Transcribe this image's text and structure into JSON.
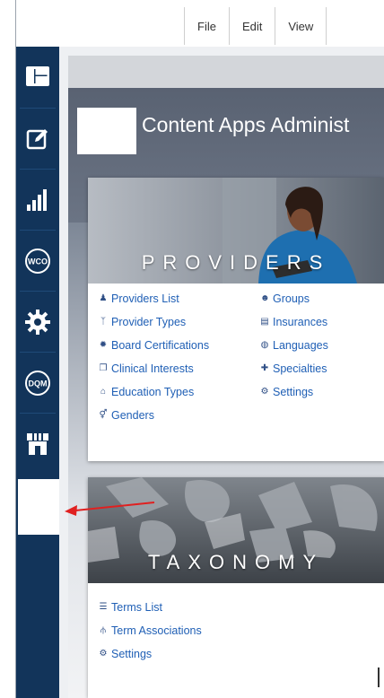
{
  "menubar": {
    "items": [
      "File",
      "Edit",
      "View"
    ]
  },
  "sidebar": {
    "icons": [
      "dashboard-icon",
      "edit-icon",
      "signal-bars-icon",
      "wco-icon",
      "gear-icon",
      "dqm-icon",
      "store-icon"
    ],
    "wco_label": "WCO",
    "dqm_label": "DQM"
  },
  "header": {
    "title": "Content Apps Administ"
  },
  "providers_card": {
    "title": "PROVIDERS",
    "links_left": [
      "Providers List",
      "Provider Types",
      "Board Certifications",
      "Clinical Interests",
      "Education Types",
      "Genders"
    ],
    "links_right": [
      "Groups",
      "Insurances",
      "Languages",
      "Specialties",
      "Settings"
    ]
  },
  "taxonomy_card": {
    "title": "TAXONOMY",
    "links": [
      "Terms List",
      "Term Associations",
      "Settings"
    ]
  },
  "colors": {
    "sidebar": "#12345a",
    "link": "#1f5fb5",
    "arrow": "#e02020"
  }
}
